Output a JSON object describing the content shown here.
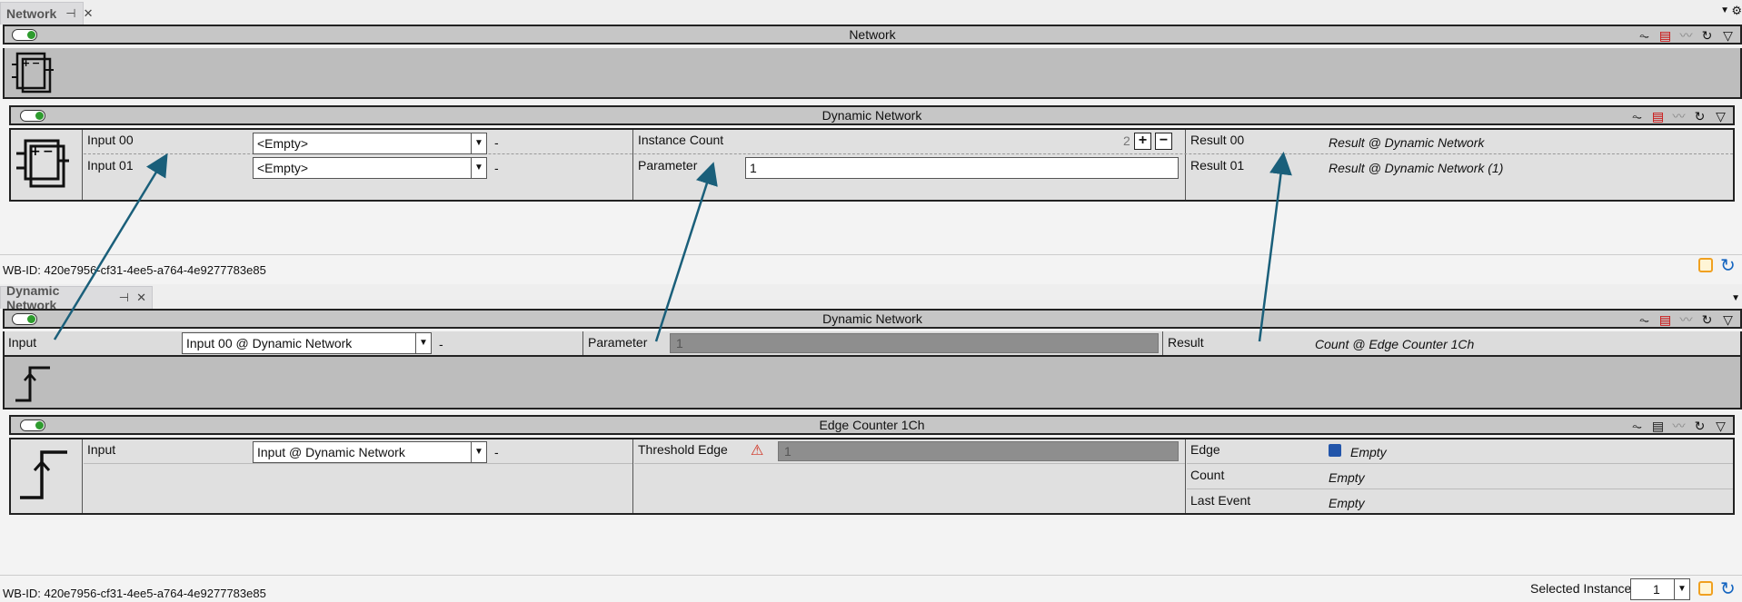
{
  "top_tab": {
    "label": "Network"
  },
  "network_panel": {
    "title": "Network"
  },
  "dynamic_network_top": {
    "title": "Dynamic Network",
    "inputs": [
      {
        "label": "Input 00",
        "value": "<Empty>",
        "dash": "-"
      },
      {
        "label": "Input 01",
        "value": "<Empty>",
        "dash": "-"
      }
    ],
    "instance_count": {
      "label": "Instance Count",
      "value": "2",
      "plus": "+",
      "minus": "−"
    },
    "parameter": {
      "label": "Parameter",
      "value": "1"
    },
    "results": [
      {
        "label": "Result 00",
        "value": "Result @ Dynamic Network"
      },
      {
        "label": "Result 01",
        "value": "Result @ Dynamic Network (1)"
      }
    ]
  },
  "status_top": {
    "wbid": "WB-ID: 420e7956-cf31-4ee5-a764-4e9277783e85"
  },
  "bottom_tab": {
    "label": "Dynamic Network"
  },
  "dynamic_network_bottom": {
    "title": "Dynamic Network",
    "input": {
      "label": "Input",
      "value": "Input 00 @ Dynamic Network",
      "dash": "-"
    },
    "parameter": {
      "label": "Parameter",
      "value": "1"
    },
    "result": {
      "label": "Result",
      "value": "Count @ Edge Counter 1Ch"
    }
  },
  "edge_counter": {
    "title": "Edge Counter 1Ch",
    "input": {
      "label": "Input",
      "value": "Input @ Dynamic Network",
      "dash": "-"
    },
    "threshold": {
      "label": "Threshold Edge",
      "value": "1"
    },
    "outputs": [
      {
        "label": "Edge",
        "value": "Empty"
      },
      {
        "label": "Count",
        "value": "Empty"
      },
      {
        "label": "Last Event",
        "value": "Empty"
      }
    ]
  },
  "status_bottom": {
    "wbid": "WB-ID: 420e7956-cf31-4ee5-a764-4e9277783e85",
    "selected_instance_label": "Selected Instance:",
    "selected_instance_value": "1"
  },
  "colors": {
    "accent": "#1a5f7a",
    "toggle_on": "#2e9b2e",
    "warn": "#f0a020",
    "refresh": "#1565c0"
  }
}
